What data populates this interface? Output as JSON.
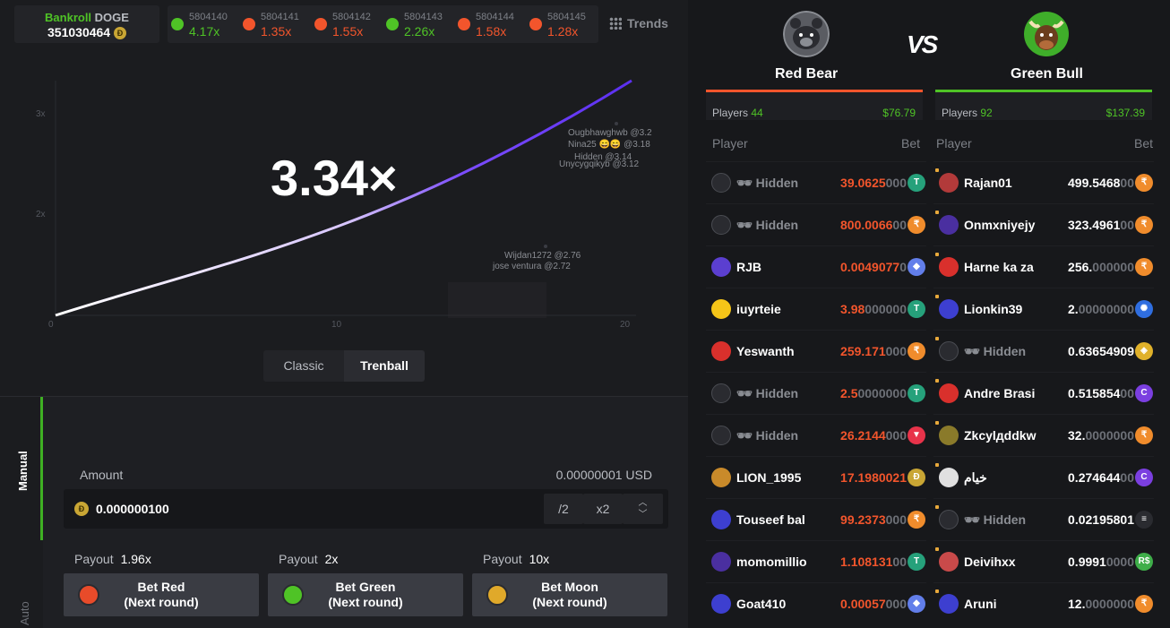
{
  "bankroll": {
    "label_green": "Bankroll",
    "label_currency": "DOGE",
    "value": "351030464",
    "coin_icon": "doge-coin-icon"
  },
  "history": [
    {
      "id": "5804140",
      "multiplier": "4.17x",
      "color": "#4fc326"
    },
    {
      "id": "5804141",
      "multiplier": "1.35x",
      "color": "#f2552c"
    },
    {
      "id": "5804142",
      "multiplier": "1.55x",
      "color": "#f2552c"
    },
    {
      "id": "5804143",
      "multiplier": "2.26x",
      "color": "#4fc326"
    },
    {
      "id": "5804144",
      "multiplier": "1.58x",
      "color": "#f2552c"
    },
    {
      "id": "5804145",
      "multiplier": "1.28x",
      "color": "#f2552c"
    }
  ],
  "trends_label": "Trends",
  "game": {
    "current_multiplier": "3.34×",
    "y_ticks": [
      "3x",
      "2x"
    ],
    "x_ticks": [
      "0",
      "10",
      "20"
    ],
    "cashouts": [
      {
        "text": "Ougbhawghwb @3.2"
      },
      {
        "text": "Nina25 😄😄 @3.18"
      },
      {
        "text": "Hidden @3.14"
      },
      {
        "text": "Unycygqikyb @3.12"
      },
      {
        "text": "Wijdan1272 @2.76"
      },
      {
        "text": "jose ventura @2.72"
      }
    ]
  },
  "modes": {
    "classic": "Classic",
    "trenball": "Trenball"
  },
  "tabs": {
    "manual": "Manual",
    "auto": "Auto"
  },
  "bet": {
    "amount_label": "Amount",
    "amount_usd": "0.00000001 USD",
    "amount_value": "0.000000100",
    "half_label": "/2",
    "double_label": "x2",
    "buttons": [
      {
        "payout_label": "Payout",
        "payout": "1.96x",
        "line1": "Bet Red",
        "line2": "(Next round)",
        "color": "#e84b2a"
      },
      {
        "payout_label": "Payout",
        "payout": "2x",
        "line1": "Bet Green",
        "line2": "(Next round)",
        "color": "#4fc326"
      },
      {
        "payout_label": "Payout",
        "payout": "10x",
        "line1": "Bet Moon",
        "line2": "(Next round)",
        "color": "#e0a92a"
      }
    ]
  },
  "teams": {
    "vs": "VS",
    "red": {
      "name": "Red Bear",
      "players_label": "Players",
      "players": "44",
      "amount": "$76.79",
      "color": "#f2552c"
    },
    "green": {
      "name": "Green Bull",
      "players_label": "Players",
      "players": "92",
      "amount": "$137.39",
      "color": "#4fc326"
    },
    "col_player": "Player",
    "col_bet": "Bet"
  },
  "red_players": [
    {
      "name": "Hidden",
      "hidden": true,
      "bet_main": "39.0625",
      "bet_dim": "000",
      "cur": "T",
      "cur_color": "#26a17b",
      "av": "#2a2b30"
    },
    {
      "name": "Hidden",
      "hidden": true,
      "bet_main": "800.0066",
      "bet_dim": "00",
      "cur": "₹",
      "cur_color": "#f08c2c",
      "av": "#2a2b30"
    },
    {
      "name": "RJB",
      "hidden": false,
      "bet_main": "0.0049077",
      "bet_dim": "0",
      "cur": "◆",
      "cur_color": "#627eea",
      "av": "#5b3fd0"
    },
    {
      "name": "iuyrteie",
      "hidden": false,
      "bet_main": "3.98",
      "bet_dim": "000000",
      "cur": "T",
      "cur_color": "#26a17b",
      "av": "#f5c518"
    },
    {
      "name": "Yeswanth",
      "hidden": false,
      "bet_main": "259.171",
      "bet_dim": "000",
      "cur": "₹",
      "cur_color": "#f08c2c",
      "av": "#d9302c"
    },
    {
      "name": "Hidden",
      "hidden": true,
      "bet_main": "2.5",
      "bet_dim": "0000000",
      "cur": "T",
      "cur_color": "#26a17b",
      "av": "#2a2b30"
    },
    {
      "name": "Hidden",
      "hidden": true,
      "bet_main": "26.2144",
      "bet_dim": "000",
      "cur": "▼",
      "cur_color": "#e8334a",
      "av": "#2a2b30"
    },
    {
      "name": "LION_1995",
      "hidden": false,
      "bet_main": "17.1980021",
      "bet_dim": "",
      "cur": "Ð",
      "cur_color": "#c9a634",
      "av": "#c98a2a"
    },
    {
      "name": "Touseef bal",
      "hidden": false,
      "bet_main": "99.2373",
      "bet_dim": "000",
      "cur": "₹",
      "cur_color": "#f08c2c",
      "av": "#3d3fd0"
    },
    {
      "name": "momomillio",
      "hidden": false,
      "bet_main": "1.108131",
      "bet_dim": "00",
      "cur": "T",
      "cur_color": "#26a17b",
      "av": "#4a2fa0"
    },
    {
      "name": "Goat410",
      "hidden": false,
      "bet_main": "0.00057",
      "bet_dim": "000",
      "cur": "◆",
      "cur_color": "#627eea",
      "av": "#3d3fd0"
    }
  ],
  "green_players": [
    {
      "name": "Rajan01",
      "hidden": false,
      "bet_main": "499.5468",
      "bet_dim": "00",
      "cur": "₹",
      "cur_color": "#f08c2c",
      "av": "#b23a3a"
    },
    {
      "name": "Onmxniyejy",
      "hidden": false,
      "bet_main": "323.4961",
      "bet_dim": "00",
      "cur": "₹",
      "cur_color": "#f08c2c",
      "av": "#4a2fa0"
    },
    {
      "name": "Harne ka za",
      "hidden": false,
      "bet_main": "256.",
      "bet_dim": "000000",
      "cur": "₹",
      "cur_color": "#f08c2c",
      "av": "#d9302c"
    },
    {
      "name": "Lionkin39",
      "hidden": false,
      "bet_main": "2.",
      "bet_dim": "00000000",
      "cur": "✺",
      "cur_color": "#2f6ee0",
      "av": "#3d3fd0"
    },
    {
      "name": "Hidden",
      "hidden": true,
      "bet_main": "0.63654909",
      "bet_dim": "",
      "cur": "◈",
      "cur_color": "#e0b12a",
      "av": "#2a2b30"
    },
    {
      "name": "Andre Brasi",
      "hidden": false,
      "bet_main": "0.515854",
      "bet_dim": "00",
      "cur": "C",
      "cur_color": "#7b3fe0",
      "av": "#d9302c"
    },
    {
      "name": "Zkcylдddkw",
      "hidden": false,
      "bet_main": "32.",
      "bet_dim": "0000000",
      "cur": "₹",
      "cur_color": "#f08c2c",
      "av": "#8a7a2a"
    },
    {
      "name": "خيام",
      "hidden": false,
      "bet_main": "0.274644",
      "bet_dim": "00",
      "cur": "C",
      "cur_color": "#7b3fe0",
      "av": "#e0e0e0"
    },
    {
      "name": "Hidden",
      "hidden": true,
      "bet_main": "0.02195801",
      "bet_dim": "",
      "cur": "≡",
      "cur_color": "#2a2b30",
      "av": "#2a2b30"
    },
    {
      "name": "Deivihxx",
      "hidden": false,
      "bet_main": "0.9991",
      "bet_dim": "0000",
      "cur": "R$",
      "cur_color": "#3fae4a",
      "av": "#c94a4a"
    },
    {
      "name": "Aruni",
      "hidden": false,
      "bet_main": "12.",
      "bet_dim": "0000000",
      "cur": "₹",
      "cur_color": "#f08c2c",
      "av": "#3d3fd0"
    }
  ]
}
